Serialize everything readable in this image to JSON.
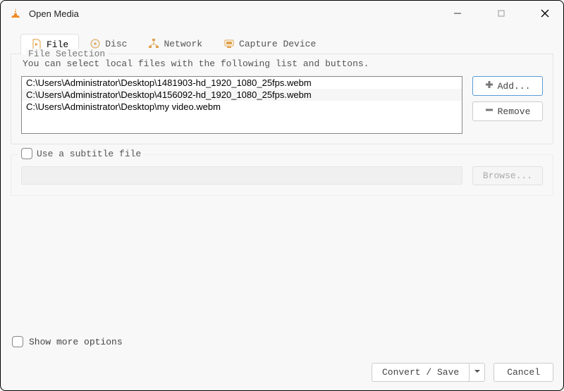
{
  "window": {
    "title": "Open Media"
  },
  "tabs": {
    "file": "File",
    "disc": "Disc",
    "network": "Network",
    "capture": "Capture Device"
  },
  "fileSelection": {
    "legend": "File Selection",
    "hint": "You can select local files with the following list and buttons.",
    "files": [
      "C:\\Users\\Administrator\\Desktop\\1481903-hd_1920_1080_25fps.webm",
      "C:\\Users\\Administrator\\Desktop\\4156092-hd_1920_1080_25fps.webm",
      "C:\\Users\\Administrator\\Desktop\\my video.webm"
    ],
    "addLabel": "Add...",
    "removeLabel": "Remove"
  },
  "subtitle": {
    "legend": "Use a subtitle file",
    "browseLabel": "Browse..."
  },
  "showMoreLabel": "Show more options",
  "footer": {
    "convertLabel": "Convert / Save",
    "cancelLabel": "Cancel"
  }
}
